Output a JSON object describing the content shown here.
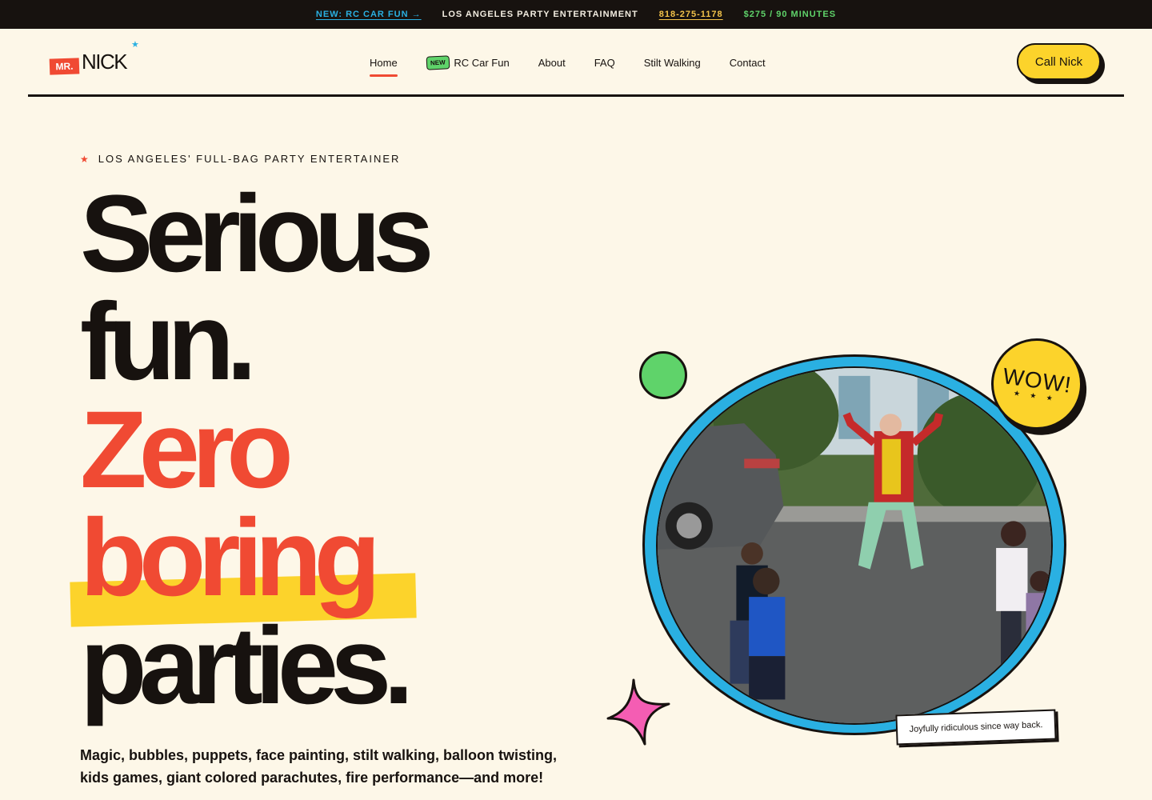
{
  "topbar": {
    "new_link": "NEW: RC CAR FUN →",
    "tagline": "LOS ANGELES PARTY ENTERTAINMENT",
    "phone": "818-275-1178",
    "price": "$275 / 90 MINUTES"
  },
  "logo": {
    "mr": "MR.",
    "name": "NICK",
    "star": "★"
  },
  "nav": {
    "items": [
      {
        "label": "Home",
        "active": true
      },
      {
        "label": "RC Car Fun",
        "badge": "NEW"
      },
      {
        "label": "About"
      },
      {
        "label": "FAQ"
      },
      {
        "label": "Stilt Walking"
      },
      {
        "label": "Contact"
      }
    ]
  },
  "cta": {
    "label": "Call Nick"
  },
  "hero": {
    "eyebrow_star": "★",
    "eyebrow": "LOS ANGELES' FULL-BAG PARTY ENTERTAINER",
    "lines": [
      "Serious",
      "fun.",
      "Zero",
      "boring",
      "parties."
    ],
    "subcopy": "Magic, bubbles, puppets, face painting, stilt walking, balloon twisting, kids games, giant colored parachutes, fire performance—and more!"
  },
  "photo": {
    "sticker_text": "WOW!",
    "sticker_stars": "★ ★ ★",
    "caption": "Joyfully ridiculous since way back."
  },
  "colors": {
    "background": "#fdf7e8",
    "ink": "#17120f",
    "red": "#f04a33",
    "yellow": "#fcd32b",
    "blue": "#2ab0e2",
    "green": "#5fd36a",
    "pink": "#f45db3"
  }
}
